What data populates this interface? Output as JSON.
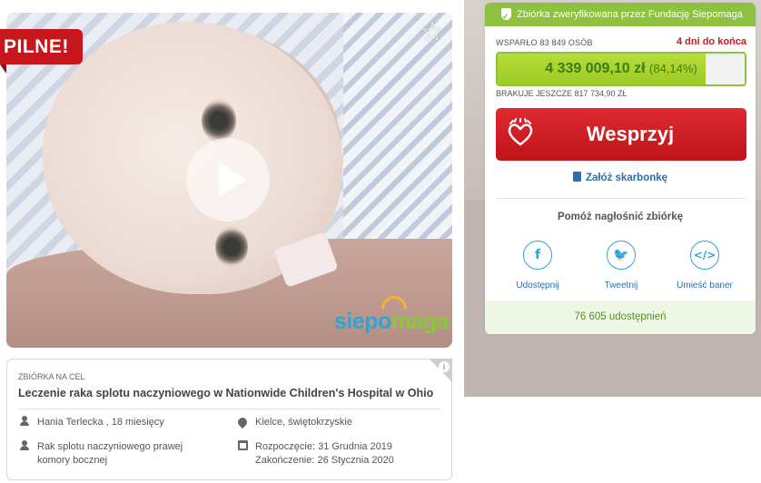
{
  "badge": {
    "urgent": "PILNE!"
  },
  "logo": {
    "part1": "siepo",
    "part2": "maga"
  },
  "fundraiser": {
    "goal_label": "ZBIÓRKA NA CEL",
    "title": "Leczenie raka splotu naczyniowego w Nationwide Children's Hospital w Ohio",
    "person": "Hania Terlecka , 18 miesięcy",
    "location": "Kielce, świętokrzyskie",
    "diagnosis": "Rak splotu naczyniowego prawej komory bocznej",
    "start": "Rozpoczęcie: 31 Grudnia 2019",
    "end": "Zakończenie: 26 Stycznia 2020"
  },
  "donation": {
    "verified_text": "Zbiórka zweryfikowana przez Fundację Siepomaga",
    "supporters": "WSPARŁO 83 849 OSÓB",
    "deadline": "4 dni do końca",
    "amount": "4 339 009,10 zł",
    "percent": "(84,14%)",
    "progress_fraction": 0.8414,
    "missing": "BRAKUJE JESZCZE 817 734,90 ZŁ",
    "support_label": "Wesprzyj",
    "piggy_label": "Załóż skarbonkę",
    "help_title": "Pomóż nagłośnić zbiórkę",
    "share_facebook": "Udostępnij",
    "share_twitter": "Tweetnij",
    "share_banner": "Umieść baner",
    "shares_count": "76 605 udostępnień"
  },
  "colors": {
    "accent_red": "#c8161d",
    "accent_green": "#8dc13f",
    "link_blue": "#2a6fb0"
  },
  "icons": [
    "star-icon",
    "play-icon",
    "shield-icon",
    "heart-hands-icon",
    "piggy-bank-icon",
    "facebook-icon",
    "twitter-icon",
    "code-icon",
    "person-icon",
    "location-pin-icon",
    "diagnosis-icon",
    "calendar-icon",
    "info-icon"
  ]
}
